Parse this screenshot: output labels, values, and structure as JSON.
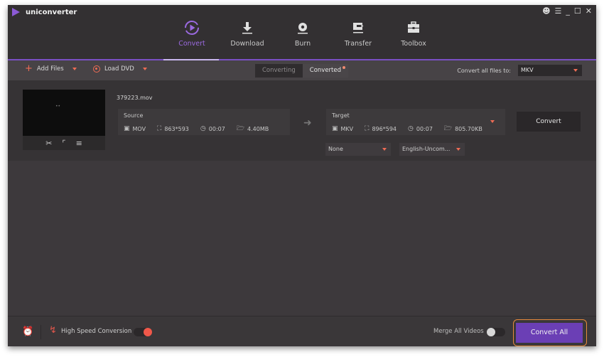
{
  "app": {
    "title": "uniconverter",
    "window_controls": [
      "user-icon",
      "menu-icon",
      "minimize-icon",
      "maximize-icon",
      "close-icon"
    ]
  },
  "nav": {
    "items": [
      {
        "label": "Convert",
        "icon": "convert-icon",
        "active": true
      },
      {
        "label": "Download",
        "icon": "download-icon",
        "active": false
      },
      {
        "label": "Burn",
        "icon": "burn-icon",
        "active": false
      },
      {
        "label": "Transfer",
        "icon": "transfer-icon",
        "active": false
      },
      {
        "label": "Toolbox",
        "icon": "toolbox-icon",
        "active": false
      }
    ]
  },
  "toolbar": {
    "add_files": "Add Files",
    "load_dvd": "Load DVD",
    "tabs": [
      {
        "label": "Converting",
        "active": false
      },
      {
        "label": "Converted",
        "active": true,
        "badge": true
      }
    ],
    "convert_all_label": "Convert all files to:",
    "convert_all_format": "MKV"
  },
  "file": {
    "name": "379223.mov",
    "source": {
      "header": "Source",
      "format": "MOV",
      "resolution": "863*593",
      "duration": "00:07",
      "size": "4.40MB"
    },
    "target": {
      "header": "Target",
      "format": "MKV",
      "resolution": "896*594",
      "duration": "00:07",
      "size": "805.70KB"
    },
    "subtitle_select": "None",
    "audio_select": "English-Uncom...",
    "convert_label": "Convert"
  },
  "footer": {
    "high_speed_label": "High Speed Conversion",
    "high_speed_on": true,
    "merge_label": "Merge All Videos",
    "merge_on": false,
    "convert_all_label": "Convert All"
  },
  "colors": {
    "accent": "#7a4fc4",
    "accent_button": "#6b3fb5",
    "highlight_ring": "#e88a3c",
    "caret": "#ef6c55",
    "toggle_on": "#f0584a"
  }
}
